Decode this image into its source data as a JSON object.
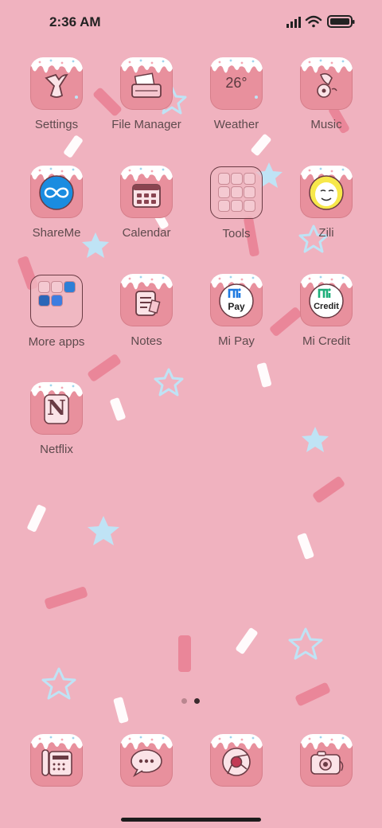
{
  "status_bar": {
    "time": "2:36 AM",
    "icons": [
      "signal-icon",
      "wifi-icon",
      "battery-icon"
    ]
  },
  "apps": [
    {
      "label": "Settings",
      "icon": "wrench-icon"
    },
    {
      "label": "File Manager",
      "icon": "folder-icon"
    },
    {
      "label": "Weather",
      "icon": "weather-icon",
      "temperature": "26°"
    },
    {
      "label": "Music",
      "icon": "gramophone-icon"
    },
    {
      "label": "ShareMe",
      "icon": "infinity-icon"
    },
    {
      "label": "Calendar",
      "icon": "calendar-icon"
    },
    {
      "label": "Tools",
      "icon": "tools-folder-icon"
    },
    {
      "label": "Zili",
      "icon": "zili-face-icon"
    },
    {
      "label": "More apps",
      "icon": "more-apps-folder-icon"
    },
    {
      "label": "Notes",
      "icon": "notes-icon"
    },
    {
      "label": "Mi Pay",
      "icon": "mi-pay-icon",
      "logo_text": "Pay"
    },
    {
      "label": "Mi Credit",
      "icon": "mi-credit-icon",
      "logo_text": "Credit"
    },
    {
      "label": "Netflix",
      "icon": "netflix-icon",
      "logo_text": "N"
    }
  ],
  "dock": [
    {
      "icon": "phone-icon"
    },
    {
      "icon": "messages-icon"
    },
    {
      "icon": "chrome-icon"
    },
    {
      "icon": "camera-icon"
    }
  ],
  "page_indicator": {
    "pages": 2,
    "current": 2
  },
  "colors": {
    "wallpaper": "#f0b2bf",
    "tile": "#e8909d",
    "label": "#5e4a4d",
    "star": "#bfe3f5"
  }
}
